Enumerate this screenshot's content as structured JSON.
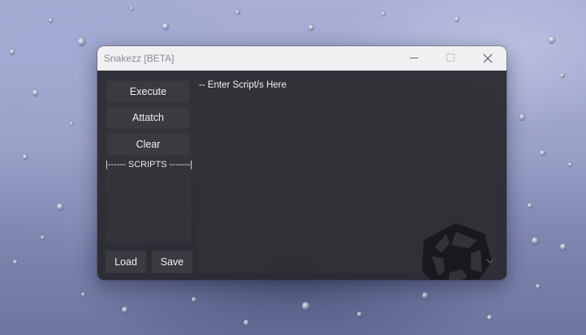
{
  "window": {
    "title": "Snakezz [BETA]"
  },
  "titlebar": {
    "minimize_icon": "minimize-icon",
    "maximize_icon": "maximize-icon",
    "close_icon": "close-icon"
  },
  "sidebar": {
    "execute_label": "Execute",
    "attatch_label": "Attatch",
    "clear_label": "Clear",
    "scripts_header": "|------ SCRIPTS -------|",
    "load_label": "Load",
    "save_label": "Save"
  },
  "editor": {
    "value": "-- Enter Script/s Here"
  },
  "colors": {
    "titlebar_bg": "#f0f0f3",
    "window_bg": "#28282e",
    "button_bg": "#3a3a40",
    "text": "#f1f1f4"
  }
}
